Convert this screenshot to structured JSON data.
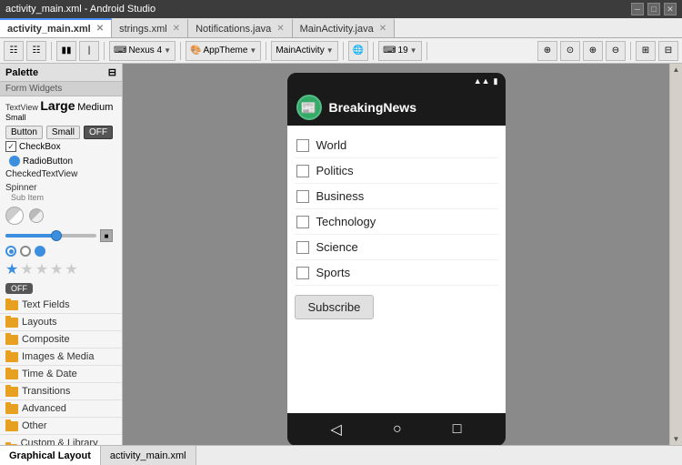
{
  "titleBar": {
    "title": "activity_main.xml - Android Studio"
  },
  "tabs": [
    {
      "id": "activity_main",
      "label": "activity_main.xml",
      "active": true
    },
    {
      "id": "strings",
      "label": "strings.xml",
      "active": false
    },
    {
      "id": "notifications_java",
      "label": "Notifications.java",
      "active": false
    },
    {
      "id": "mainactivity_java",
      "label": "MainActivity.java",
      "active": false
    }
  ],
  "toolbar": {
    "deviceDropdown": "Nexus 4",
    "themeDropdown": "AppTheme",
    "activityDropdown": "MainActivity",
    "apiDropdown": "19",
    "zoomButtons": [
      "zoom-in",
      "zoom-out",
      "zoom-fit",
      "zoom-actual"
    ],
    "layoutToggle": [
      "portrait",
      "landscape"
    ],
    "viewToggle": [
      "design",
      "split"
    ]
  },
  "palette": {
    "title": "Palette",
    "sections": {
      "formWidgets": "Form Widgets",
      "textFields": "Text Fields",
      "layouts": "Layouts",
      "composite": "Composite",
      "imagesMedia": "Images & Media",
      "timeDate": "Time & Date",
      "transitions": "Transitions",
      "advanced": "Advanced",
      "other": "Other",
      "customLibrary": "Custom & Library Views"
    },
    "textViewSizes": "Large Medium Small",
    "buttons": [
      "Button",
      "Small",
      "OFF"
    ],
    "checkboxLabel": "CheckBox",
    "radioButtonLabel": "RadioButton",
    "checkedTextViewLabel": "CheckedTextView",
    "spinnerLabel": "Spinner",
    "spinnerSubItem": "Sub Item"
  },
  "phone": {
    "appTitle": "BreakingNews",
    "checkboxItems": [
      {
        "label": "World",
        "checked": false
      },
      {
        "label": "Politics",
        "checked": false
      },
      {
        "label": "Business",
        "checked": false
      },
      {
        "label": "Technology",
        "checked": false
      },
      {
        "label": "Science",
        "checked": false
      },
      {
        "label": "Sports",
        "checked": false
      }
    ],
    "subscribeButton": "Subscribe"
  },
  "bottomTabs": [
    {
      "id": "graphical",
      "label": "Graphical Layout",
      "active": true
    },
    {
      "id": "activity_main_xml",
      "label": "activity_main.xml",
      "active": false
    }
  ]
}
